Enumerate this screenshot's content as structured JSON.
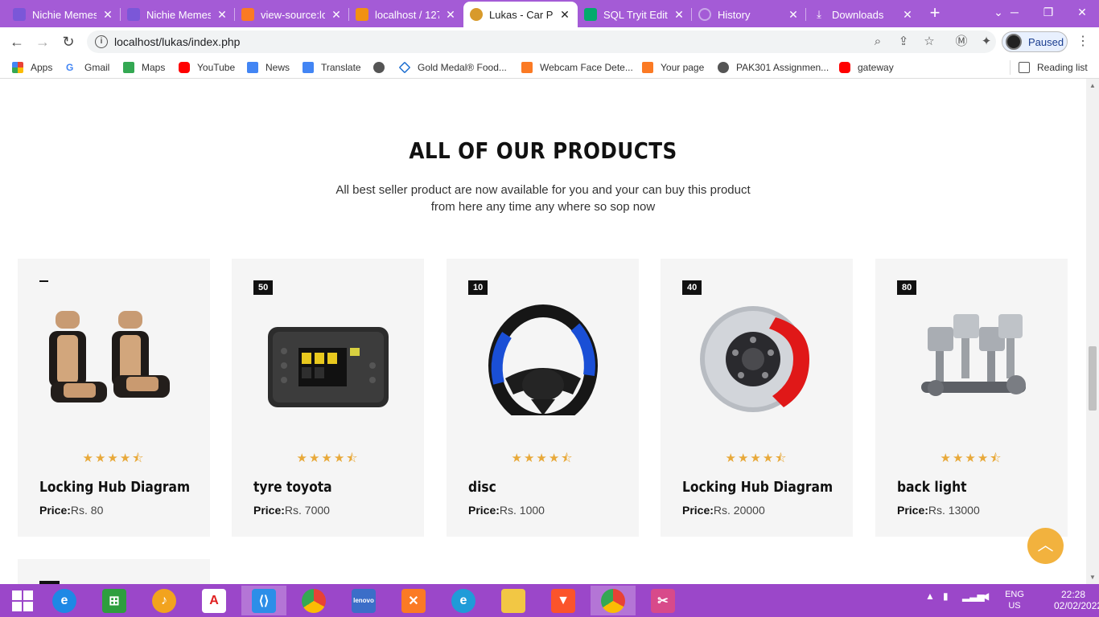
{
  "tabs": [
    {
      "title": "Nichie Memes",
      "favicon": "purple-tab-icon",
      "color": "#7b57d8"
    },
    {
      "title": "Nichie Memes",
      "favicon": "purple-tab-icon",
      "color": "#7b57d8"
    },
    {
      "title": "view-source:lo",
      "favicon": "xampp-icon",
      "color": "#fb7a24"
    },
    {
      "title": "localhost / 127",
      "favicon": "phpmyadmin-icon",
      "color": "#f29111"
    },
    {
      "title": "Lukas - Car Pa",
      "favicon": "car-icon",
      "color": "#d89a2b"
    },
    {
      "title": "SQL Tryit Edito",
      "favicon": "w3-icon",
      "color": "#04aa6d"
    },
    {
      "title": "History",
      "favicon": "history-icon",
      "color": "#c9a8e8"
    },
    {
      "title": "Downloads",
      "favicon": "download-icon",
      "color": "#c9a8e8"
    }
  ],
  "toolbar": {
    "url": "localhost/lukas/index.php",
    "profile_label": "Paused",
    "info_glyph": "i"
  },
  "bookmarks": [
    {
      "label": "Apps",
      "icon": "apps-grid-icon",
      "color": "#e94235"
    },
    {
      "label": "Gmail",
      "icon": "google-icon",
      "color": "#4285f4"
    },
    {
      "label": "Maps",
      "icon": "maps-icon",
      "color": "#34a853"
    },
    {
      "label": "YouTube",
      "icon": "youtube-icon",
      "color": "#ff0000"
    },
    {
      "label": "News",
      "icon": "news-icon",
      "color": "#4285f4"
    },
    {
      "label": "Translate",
      "icon": "translate-icon",
      "color": "#4285f4"
    },
    {
      "label": "",
      "icon": "globe-icon",
      "color": "#555555"
    },
    {
      "label": "Gold Medal® Food...",
      "icon": "goldmedal-icon",
      "color": "#1f6fd0"
    },
    {
      "label": "Webcam Face Dete...",
      "icon": "xampp-icon",
      "color": "#fb7a24"
    },
    {
      "label": "Your page",
      "icon": "xampp-icon",
      "color": "#fb7a24"
    },
    {
      "label": "PAK301 Assignmen...",
      "icon": "globe-icon",
      "color": "#555555"
    },
    {
      "label": "gateway",
      "icon": "youtube-icon",
      "color": "#ff0000"
    }
  ],
  "reading_list": "Reading list",
  "section": {
    "title": "ALL OF OUR PRODUCTS",
    "desc_line1": "All best seller product are now available for you and your can buy this product",
    "desc_line2": "from here any time any where so sop now"
  },
  "products": [
    {
      "badge": "",
      "name": "Locking Hub Diagram",
      "price_label": "Price:",
      "price": "Rs. 80",
      "image": "car-seat-image",
      "rating": 4.5
    },
    {
      "badge": "50",
      "name": "tyre toyota",
      "price_label": "Price:",
      "price": "Rs. 7000",
      "image": "obd-scanner-image",
      "rating": 4.5
    },
    {
      "badge": "10",
      "name": "disc",
      "price_label": "Price:",
      "price": "Rs. 1000",
      "image": "steering-wheel-image",
      "rating": 4.5
    },
    {
      "badge": "40",
      "name": "Locking Hub Diagram",
      "price_label": "Price:",
      "price": "Rs. 20000",
      "image": "brake-disc-image",
      "rating": 4.5
    },
    {
      "badge": "80",
      "name": "back light",
      "price_label": "Price:",
      "price": "Rs. 13000",
      "image": "engine-pistons-image",
      "rating": 4.5
    }
  ],
  "taskbar": {
    "apps": [
      {
        "icon": "windows-start-icon",
        "color": "#ffffff"
      },
      {
        "icon": "internet-explorer-icon",
        "color": "#1e88e5"
      },
      {
        "icon": "store-icon",
        "color": "#2e9e3e"
      },
      {
        "icon": "music-player-icon",
        "color": "#f2a31e"
      },
      {
        "icon": "adobe-reader-icon",
        "color": "#e02020"
      },
      {
        "icon": "vscode-icon",
        "color": "#2c8ee8"
      },
      {
        "icon": "chrome-icon",
        "color": "#e84235"
      },
      {
        "icon": "lenovo-icon",
        "color": "#3b6ec8"
      },
      {
        "icon": "xampp-icon",
        "color": "#fb7a24"
      },
      {
        "icon": "edge-icon",
        "color": "#1f9bd8"
      },
      {
        "icon": "file-explorer-icon",
        "color": "#f2c744"
      },
      {
        "icon": "brave-icon",
        "color": "#fb542b"
      },
      {
        "icon": "chrome-icon",
        "color": "#e84235"
      },
      {
        "icon": "snipping-tool-icon",
        "color": "#d84a8a"
      }
    ],
    "lang_top": "ENG",
    "lang_bottom": "US",
    "time": "22:28",
    "date": "02/02/2022"
  },
  "colors": {
    "tabbar": "#a45bd6",
    "taskbar": "#9b47c9",
    "accent": "#f2b23e",
    "stars": "#e8a93a"
  }
}
